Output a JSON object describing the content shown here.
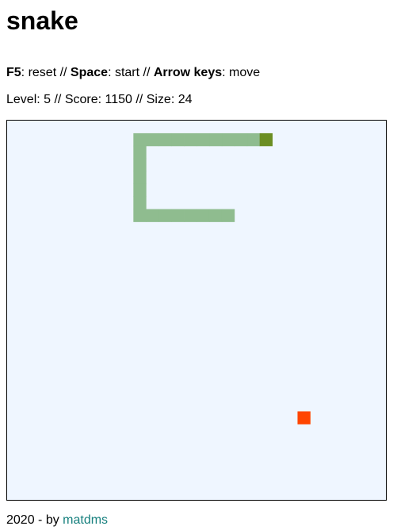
{
  "title": "snake",
  "controls": {
    "reset_key": "F5",
    "reset_sep": ": reset // ",
    "start_key": "Space",
    "start_sep": ": start // ",
    "move_key": "Arrow keys",
    "move_sep": ": move"
  },
  "stats": {
    "text": "Level: 5 // Score: 1150 // Size: 24"
  },
  "board": {
    "grid_cells": 30,
    "background": "#eff6ff",
    "snake_body_color": "#8fbc8f",
    "snake_head_color": "#6b8e23",
    "food_color": "#ff4500",
    "snake_cells": [
      [
        19,
        1
      ],
      [
        18,
        1
      ],
      [
        17,
        1
      ],
      [
        16,
        1
      ],
      [
        15,
        1
      ],
      [
        14,
        1
      ],
      [
        13,
        1
      ],
      [
        12,
        1
      ],
      [
        11,
        1
      ],
      [
        10,
        1
      ],
      [
        10,
        2
      ],
      [
        10,
        3
      ],
      [
        10,
        4
      ],
      [
        10,
        5
      ],
      [
        10,
        6
      ],
      [
        10,
        7
      ],
      [
        11,
        7
      ],
      [
        12,
        7
      ],
      [
        13,
        7
      ],
      [
        14,
        7
      ],
      [
        15,
        7
      ],
      [
        16,
        7
      ],
      [
        17,
        7
      ]
    ],
    "head_cell": [
      20,
      1
    ],
    "food_cell": [
      23,
      23
    ]
  },
  "footer": {
    "prefix": "2020 - by ",
    "author": "matdms"
  }
}
